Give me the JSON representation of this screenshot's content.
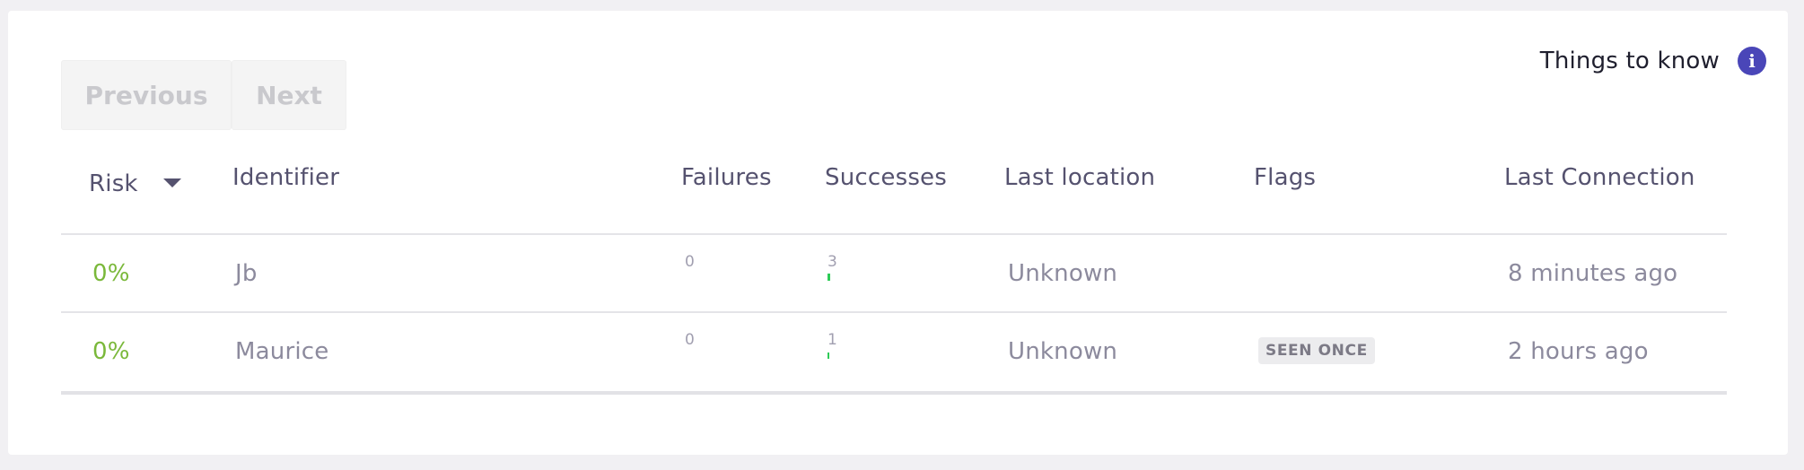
{
  "things_to_know": {
    "label": "Things to know",
    "icon": "info-icon",
    "icon_glyph": "i"
  },
  "pager": {
    "previous_label": "Previous",
    "next_label": "Next"
  },
  "table": {
    "headers": {
      "risk": "Risk",
      "identifier": "Identifier",
      "failures": "Failures",
      "successes": "Successes",
      "last_location": "Last location",
      "flags": "Flags",
      "last_connection": "Last Connection"
    },
    "rows": [
      {
        "risk": "0%",
        "identifier": "Jb",
        "failures": "0",
        "successes": "3",
        "last_location": "Unknown",
        "flags": "",
        "last_connection": "8 minutes ago"
      },
      {
        "risk": "0%",
        "identifier": "Maurice",
        "failures": "0",
        "successes": "1",
        "last_location": "Unknown",
        "flags": "SEEN ONCE",
        "last_connection": "2 hours ago"
      }
    ]
  },
  "colors": {
    "risk_text": "#7ab83a",
    "success_bar": "#2ecb57",
    "info_icon": "#4a46b8"
  }
}
